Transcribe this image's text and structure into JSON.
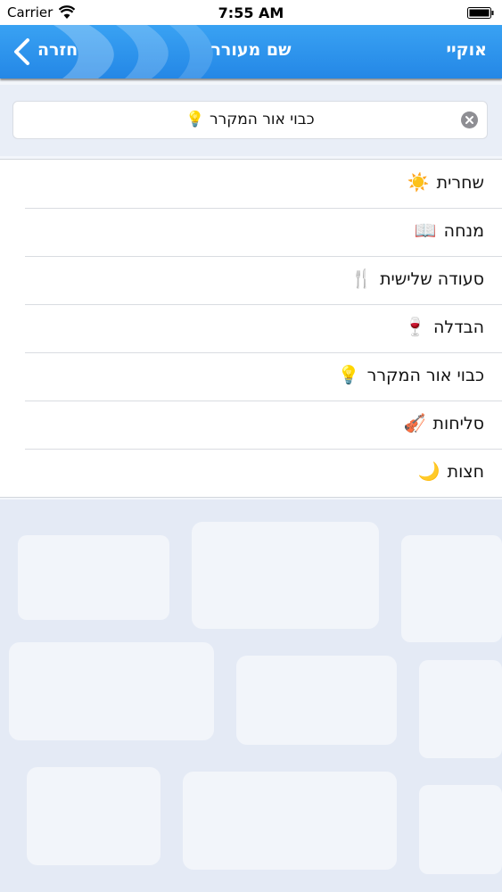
{
  "status_bar": {
    "carrier": "Carrier",
    "time": "7:55 AM"
  },
  "nav": {
    "back_label": "חזרה",
    "title": "שם מעורר",
    "ok_label": "אוקיי"
  },
  "selection": {
    "value": "כבוי אור המקרר",
    "icon": "💡"
  },
  "list": {
    "items": [
      {
        "label": "שחרית",
        "icon": "☀️"
      },
      {
        "label": "מנחה",
        "icon": "📖"
      },
      {
        "label": "סעודה שלישית",
        "icon": "🍴"
      },
      {
        "label": "הבדלה",
        "icon": "🍷"
      },
      {
        "label": "כבוי אור המקרר",
        "icon": "💡"
      },
      {
        "label": "סליחות",
        "icon": "🎻"
      },
      {
        "label": "חצות",
        "icon": "🌙"
      }
    ]
  },
  "colors": {
    "nav_blue": "#2b8fea",
    "wall_tint": "#d9e2f2"
  }
}
